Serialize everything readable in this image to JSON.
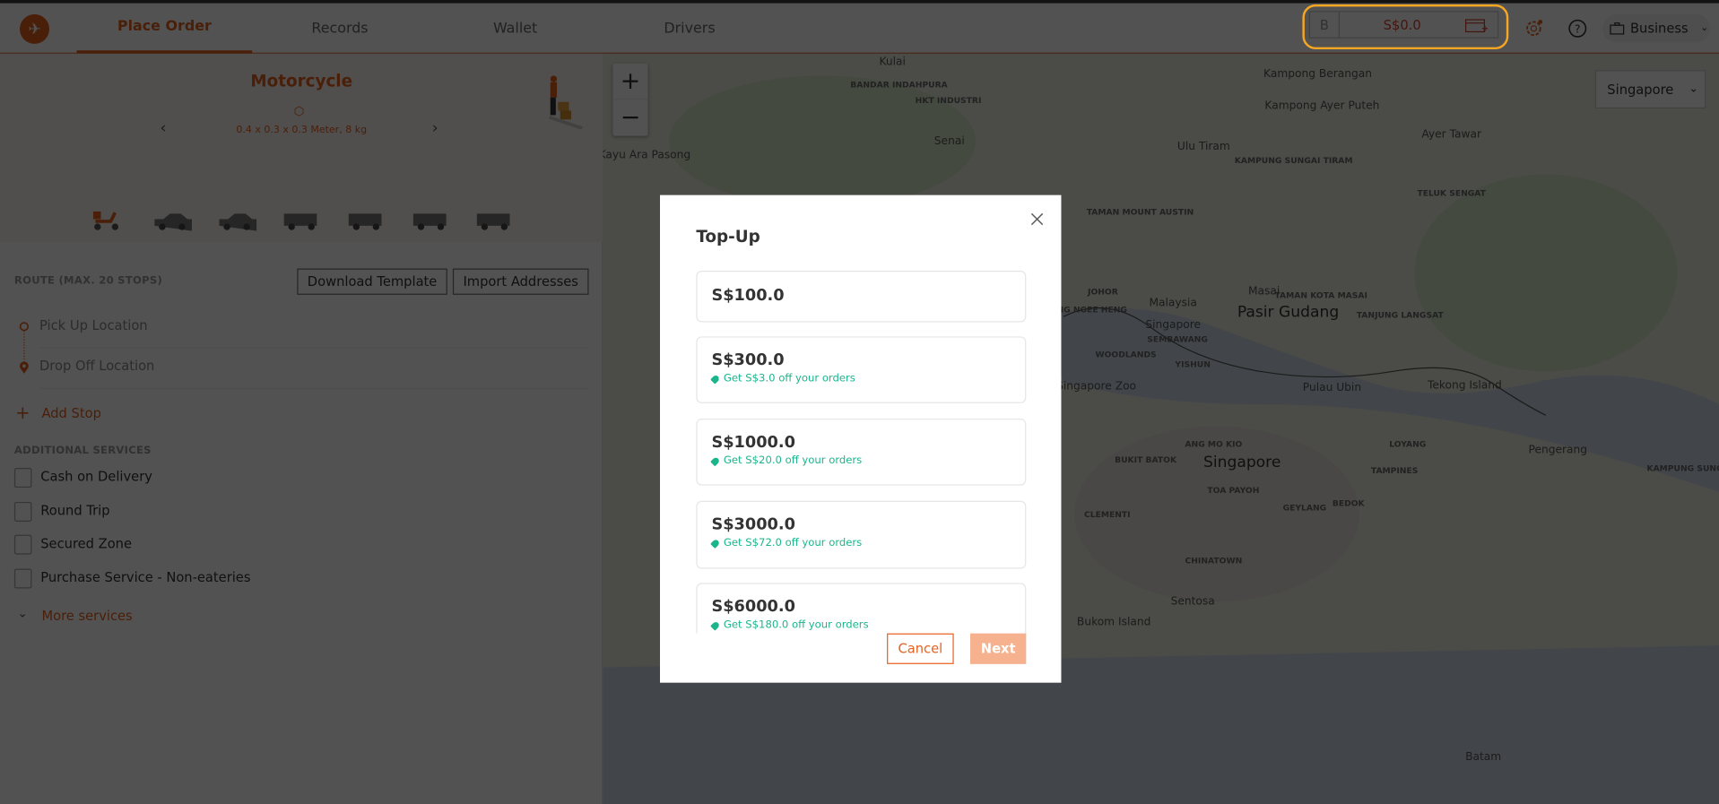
{
  "header": {
    "tabs": [
      {
        "label": "Place Order",
        "active": true
      },
      {
        "label": "Records"
      },
      {
        "label": "Wallet"
      },
      {
        "label": "Drivers"
      }
    ],
    "balance": {
      "badge": "B",
      "amount": "S$0.0",
      "icon": "wallet-add-icon"
    },
    "account": "Business",
    "accent": "#e8611f",
    "highlight_color": "#f5a623"
  },
  "vehicle": {
    "name": "Motorcycle",
    "dimensions": "0.4 x 0.3 x 0.3 Meter, 8 kg",
    "types": [
      "motorcycle",
      "car",
      "mpv",
      "van",
      "van-large",
      "truck",
      "truck-large"
    ]
  },
  "route": {
    "heading": "ROUTE (MAX. 20 STOPS)",
    "download_template": "Download Template",
    "import_addresses": "Import Addresses",
    "pickup_placeholder": "Pick Up Location",
    "dropoff_placeholder": "Drop Off Location",
    "add_stop": "Add Stop"
  },
  "services": {
    "heading": "ADDITIONAL SERVICES",
    "items": [
      "Cash on Delivery",
      "Round Trip",
      "Secured Zone",
      "Purchase Service - Non-eateries"
    ],
    "more": "More services"
  },
  "map": {
    "country": "Singapore",
    "labels": [
      "Kulai",
      "BANDAR INDAHPURA",
      "HKT INDUSTRI",
      "Senai",
      "Kayu Ara Pasong",
      "Ulu Tiram",
      "Kampong Berangan",
      "Kampong Ayer Puteh",
      "Ayer Tawar",
      "KAMPUNG SUNGAI TIRAM",
      "TELUK SENGAT",
      "TAMAN MOUNT AUSTIN",
      "JOHOR",
      "Masai",
      "TAMAN KOTA MASAI",
      "Pasir Gudang",
      "TANJUNG LANGSAT",
      "SEMBAWANG",
      "WOODLANDS",
      "YISHUN",
      "Singapore Zoo",
      "Pulau Ubin",
      "Tekong Island",
      "Pengerang",
      "ANG MO KIO",
      "Singapore",
      "LOYANG",
      "TAMPINES",
      "BUKIT BATOK",
      "TOA PAYOH",
      "GEYLANG",
      "BEDOK",
      "CLEMENTI",
      "CHINATOWN",
      "Sentosa",
      "Bukom Island",
      "Batam",
      "KAMPUNG SUNGAI RE",
      "NG NGEE HENG",
      "Malaysia",
      "Singapore"
    ]
  },
  "modal": {
    "title": "Top-Up",
    "options": [
      {
        "amount": "S$100.0",
        "promo": ""
      },
      {
        "amount": "S$300.0",
        "promo": "Get S$3.0 off your orders"
      },
      {
        "amount": "S$1000.0",
        "promo": "Get S$20.0 off your orders"
      },
      {
        "amount": "S$3000.0",
        "promo": "Get S$72.0 off your orders"
      },
      {
        "amount": "S$6000.0",
        "promo": "Get S$180.0 off your orders"
      }
    ],
    "cancel": "Cancel",
    "next": "Next",
    "promo_color": "#1bb58c"
  }
}
